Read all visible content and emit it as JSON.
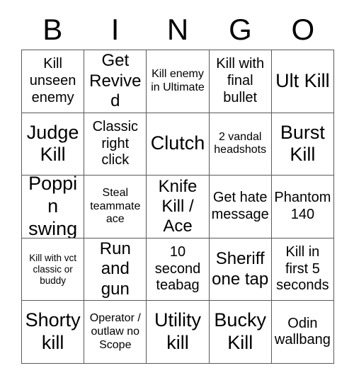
{
  "card": {
    "title": "BINGO",
    "headers": [
      "B",
      "I",
      "N",
      "G",
      "O"
    ],
    "border_color": "#595959",
    "background_color": "#ffffff",
    "text_color": "#000000",
    "rows": [
      [
        {
          "text": "Kill unseen enemy",
          "size": "md"
        },
        {
          "text": "Get Revived",
          "size": "lg"
        },
        {
          "text": "Kill enemy in Ultimate",
          "size": "sm"
        },
        {
          "text": "Kill with final bullet",
          "size": "md"
        },
        {
          "text": "Ult Kill",
          "size": "xl"
        }
      ],
      [
        {
          "text": "Judge Kill",
          "size": "xl"
        },
        {
          "text": "Classic right click",
          "size": "md"
        },
        {
          "text": "Clutch",
          "size": "xl"
        },
        {
          "text": "2 vandal headshots",
          "size": "sm"
        },
        {
          "text": "Burst Kill",
          "size": "xl"
        }
      ],
      [
        {
          "text": "Poppin swing",
          "size": "xl"
        },
        {
          "text": "Steal teammate ace",
          "size": "sm"
        },
        {
          "text": "Knife Kill / Ace",
          "size": "lg"
        },
        {
          "text": "Get hate message",
          "size": "md"
        },
        {
          "text": "Phantom 140",
          "size": "md"
        }
      ],
      [
        {
          "text": "Kill with vct classic or buddy",
          "size": "xs"
        },
        {
          "text": "Run and gun",
          "size": "lg"
        },
        {
          "text": "10 second teabag",
          "size": "md"
        },
        {
          "text": "Sheriff one tap",
          "size": "lg"
        },
        {
          "text": "Kill in first 5 seconds",
          "size": "md"
        }
      ],
      [
        {
          "text": "Shorty kill",
          "size": "xl"
        },
        {
          "text": "Operator / outlaw no Scope",
          "size": "sm"
        },
        {
          "text": "Utility kill",
          "size": "xl"
        },
        {
          "text": "Bucky Kill",
          "size": "xl"
        },
        {
          "text": "Odin wallbang",
          "size": "md"
        }
      ]
    ]
  }
}
